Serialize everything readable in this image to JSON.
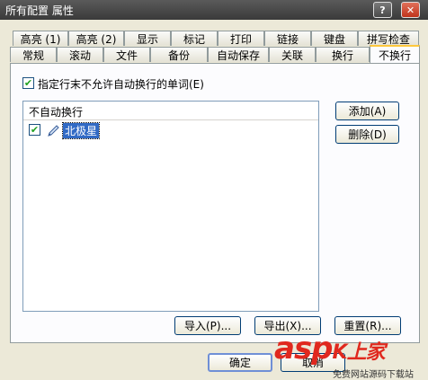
{
  "window": {
    "title": "所有配置 属性"
  },
  "titlebar_buttons": {
    "help": "?",
    "close": "✕"
  },
  "tabs_row1": [
    "高亮 (1)",
    "高亮 (2)",
    "显示",
    "标记",
    "打印",
    "链接",
    "键盘",
    "拼写检查"
  ],
  "tabs_row2": [
    "常规",
    "滚动",
    "文件",
    "备份",
    "自动保存",
    "关联",
    "换行",
    "不换行"
  ],
  "active_tab": "不换行",
  "option": {
    "label": "指定行末不允许自动换行的单词(E)",
    "checked": true
  },
  "list": {
    "header": "不自动换行",
    "items": [
      {
        "label": "北极星",
        "checked": true
      }
    ]
  },
  "buttons": {
    "add": "添加(A)",
    "delete": "删除(D)",
    "import": "导入(P)...",
    "export": "导出(X)...",
    "reset": "重置(R)...",
    "ok": "确定",
    "cancel": "取消"
  },
  "watermark": {
    "logo": "asp",
    "brand": "K上家",
    "tagline": "免费网站源码下载站"
  },
  "colors": {
    "active_tab_accent": "#ffc83c",
    "check": "#21a121",
    "watermark": "#e0281e"
  }
}
